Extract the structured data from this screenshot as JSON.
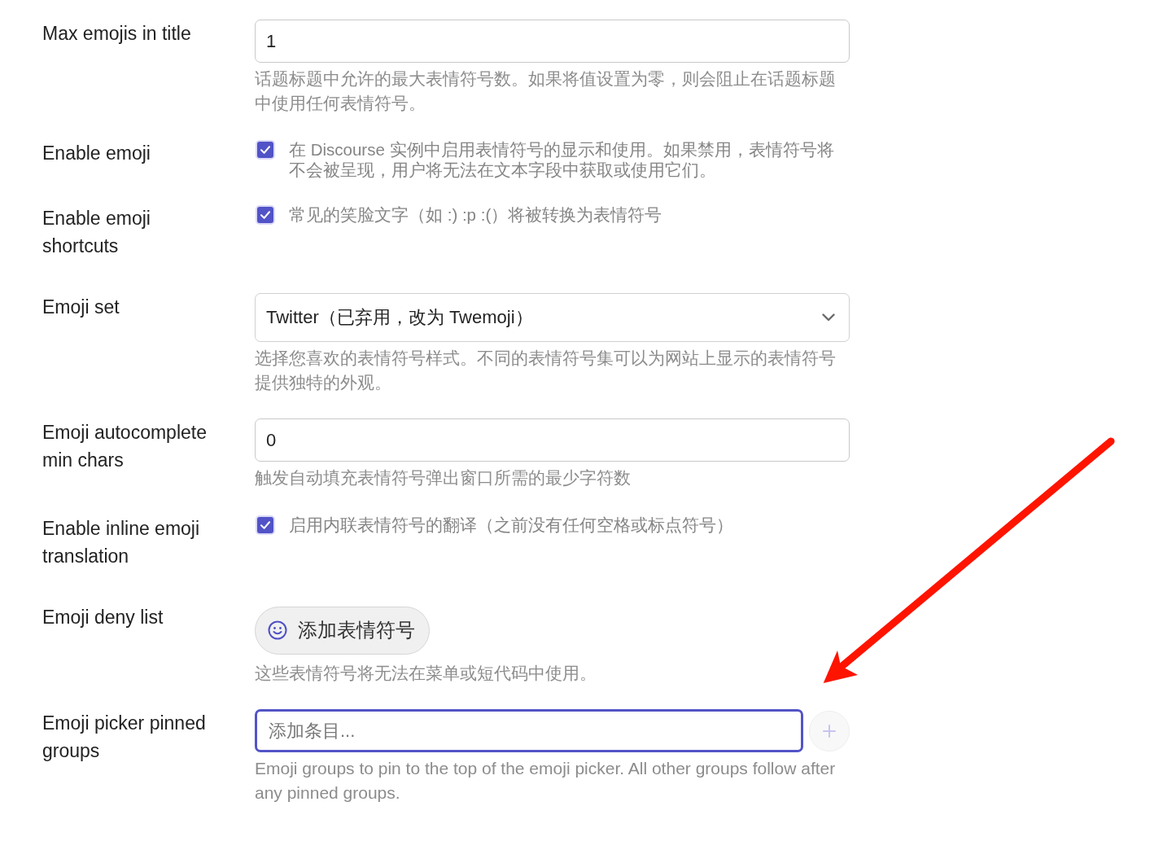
{
  "settings": [
    {
      "kind": "number",
      "label": "Max emojis in title",
      "value": "1",
      "description": "话题标题中允许的最大表情符号数。如果将值设置为零，则会阻止在话题标题中使用任何表情符号。"
    },
    {
      "kind": "checkbox",
      "label": "Enable emoji",
      "checked": true,
      "description": "在 Discourse 实例中启用表情符号的显示和使用。如果禁用，表情符号将不会被呈现，用户将无法在文本字段中获取或使用它们。"
    },
    {
      "kind": "checkbox",
      "label": "Enable emoji shortcuts",
      "checked": true,
      "description": "常见的笑脸文字（如 :) :p :(）将被转换为表情符号"
    },
    {
      "kind": "select",
      "label": "Emoji set",
      "value": "Twitter（已弃用，改为 Twemoji）",
      "description": "选择您喜欢的表情符号样式。不同的表情符号集可以为网站上显示的表情符号提供独特的外观。"
    },
    {
      "kind": "number",
      "label": "Emoji autocomplete min chars",
      "value": "0",
      "description": "触发自动填充表情符号弹出窗口所需的最少字符数"
    },
    {
      "kind": "checkbox",
      "label": "Enable inline emoji translation",
      "checked": true,
      "description": "启用内联表情符号的翻译（之前没有任何空格或标点符号）"
    },
    {
      "kind": "emoji_list",
      "label": "Emoji deny list",
      "button": "添加表情符号",
      "description": "这些表情符号将无法在菜单或短代码中使用。"
    },
    {
      "kind": "list_input",
      "label": "Emoji picker pinned groups",
      "placeholder": "添加条目...",
      "focused": true,
      "add_button": {
        "disabled": true
      },
      "description": "Emoji groups to pin to the top of the emoji picker. All other groups follow after any pinned groups."
    }
  ],
  "annotations": [
    {
      "kind": "arrow"
    }
  ]
}
